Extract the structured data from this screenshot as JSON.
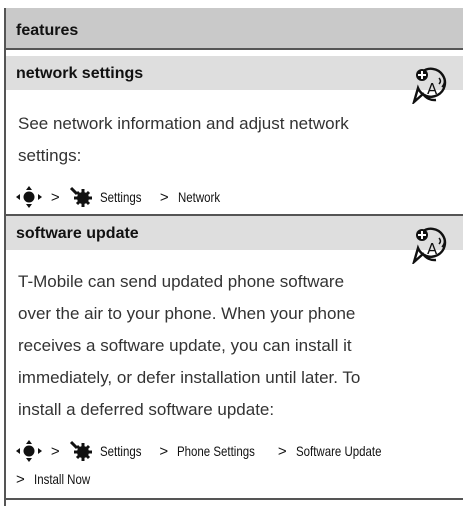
{
  "header": {
    "title": "features"
  },
  "sections": [
    {
      "title": "network settings",
      "body_lines": [
        "See network information and adjust network",
        "settings:"
      ],
      "path": {
        "step1": "Settings",
        "sep": ">",
        "step2": "Network"
      },
      "icon": "network-feature-icon"
    },
    {
      "title": "software update",
      "body_lines": [
        "T-Mobile can send updated phone software",
        "over the air to your phone. When your phone",
        "receives a software update, you can install it",
        "immediately, or defer installation until later. To",
        "install a deferred software update:"
      ],
      "path": {
        "step1": "Settings",
        "step2": "Phone Settings",
        "step3": "Software Update",
        "step4": "Install Now",
        "sep": ">"
      },
      "icon": "network-feature-icon"
    }
  ]
}
